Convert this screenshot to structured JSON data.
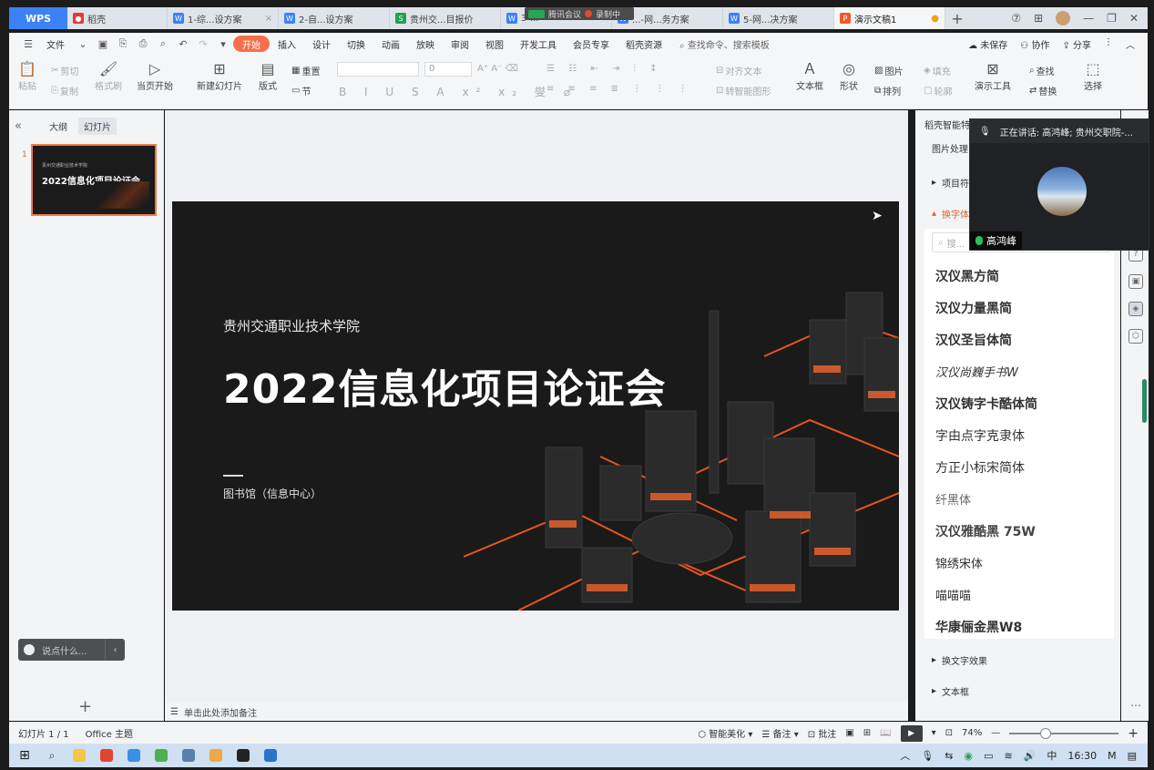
{
  "titlebar": {
    "app": "WPS",
    "tabs": [
      {
        "label": "稻壳",
        "icon": "daoke-icon",
        "color": "#e53935"
      },
      {
        "label": "1-综...设方案",
        "icon": "writer-icon",
        "color": "#3b82f6"
      },
      {
        "label": "2-自...设方案",
        "icon": "writer-icon",
        "color": "#3b82f6"
      },
      {
        "label": "贵州交...目报价",
        "icon": "sheet-icon",
        "color": "#22a052"
      },
      {
        "label": "3-...",
        "icon": "writer-icon",
        "color": "#3b82f6"
      },
      {
        "label": "...-网...务方案",
        "icon": "writer-icon",
        "color": "#3b82f6"
      },
      {
        "label": "5-网...决方案",
        "icon": "writer-icon",
        "color": "#3b82f6"
      },
      {
        "label": "演示文稿1",
        "icon": "presentation-icon",
        "color": "#f05a28"
      }
    ]
  },
  "meeting": {
    "app": "腾讯会议",
    "recording": "录制中"
  },
  "menu": {
    "file": "文件",
    "items": [
      "开始",
      "插入",
      "设计",
      "切换",
      "动画",
      "放映",
      "审阅",
      "视图",
      "开发工具",
      "会员专享",
      "稻壳资源"
    ],
    "search": "查找命令、搜索模板",
    "right": [
      "未保存",
      "协作",
      "分享"
    ]
  },
  "ribbon": {
    "paste": "粘贴",
    "cut": "剪切",
    "copy": "复制",
    "format_painter": "格式刷",
    "play_from_current": "当页开始",
    "new_slide": "新建幻灯片",
    "layout": "版式",
    "reset": "重置",
    "section": "节",
    "font_size": "0",
    "align_text": "对齐文本",
    "convert_smartart": "转智能图形",
    "textbox": "文本框",
    "shape": "形状",
    "picture": "图片",
    "fill": "填充",
    "arrange": "排列",
    "outline": "轮廓",
    "presentation_tools": "演示工具",
    "find": "查找",
    "replace": "替换",
    "select": "选择"
  },
  "leftpanel": {
    "tabs": [
      "大纲",
      "幻灯片"
    ],
    "slide_number": "1",
    "thumb_title": "2022信息化项目论证会",
    "chat_placeholder": "说点什么..."
  },
  "slide": {
    "school": "贵州交通职业技术学院",
    "title": "2022信息化项目论证会",
    "dept": "图书馆（信息中心）"
  },
  "notes": "单击此处添加备注",
  "rightpanel": {
    "header": "稻壳智能特...",
    "image_processing": "图片处理",
    "project": "项目符...",
    "replace_font": "换字体",
    "search_placeholder": "搜...",
    "fonts": [
      "汉仪黑方简",
      "汉仪力量黑简",
      "汉仪圣旨体简",
      "汉仪尚巍手书W",
      "汉仪铸字卡酷体简",
      "字由点字克隶体",
      "方正小标宋简体",
      "纤黑体",
      "汉仪雅酷黑 75W",
      "锦绣宋体",
      "喵喵喵",
      "华康俪金黑W8"
    ],
    "text_effect": "换文字效果",
    "textbox": "文本框"
  },
  "video": {
    "speaking": "正在讲话: 高鸿峰; 贵州交职院-...",
    "name": "高鸿峰"
  },
  "statusbar": {
    "slide_info": "幻灯片 1 / 1",
    "theme": "Office 主题",
    "beautify": "智能美化",
    "notes": "备注",
    "comments": "批注",
    "zoom": "74%"
  },
  "taskbar": {
    "ime": "中",
    "time": "16:30"
  }
}
